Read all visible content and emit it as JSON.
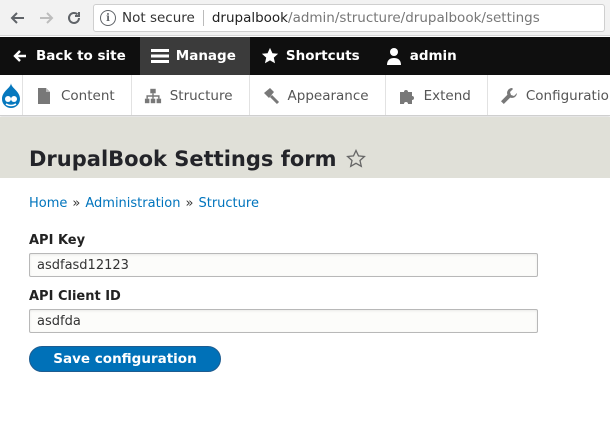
{
  "browser": {
    "security_label": "Not secure",
    "url_domain": "drupalbook",
    "url_path": "/admin/structure/drupalbook/settings"
  },
  "toolbar": {
    "items": [
      {
        "label": "Back to site",
        "icon": "drupal-drop-icon"
      },
      {
        "label": "Manage",
        "icon": "hamburger-menu-icon"
      },
      {
        "label": "Shortcuts",
        "icon": "star-icon"
      },
      {
        "label": "admin",
        "icon": "user-icon"
      }
    ]
  },
  "tray": {
    "items": [
      {
        "label": "Content",
        "icon": "file-icon"
      },
      {
        "label": "Structure",
        "icon": "sitemap-icon"
      },
      {
        "label": "Appearance",
        "icon": "paintbrush-icon"
      },
      {
        "label": "Extend",
        "icon": "puzzle-icon"
      },
      {
        "label": "Configuration",
        "icon": "wrench-icon"
      }
    ]
  },
  "page": {
    "title": "DrupalBook Settings form"
  },
  "breadcrumb": [
    "Home",
    "Administration",
    "Structure"
  ],
  "form": {
    "api_key_label": "API Key",
    "api_key_value": "asdfasd12123",
    "api_client_id_label": "API Client ID",
    "api_client_id_value": "asdfda",
    "submit_label": "Save configuration"
  },
  "colors": {
    "toolbar_bg": "#0f0f0f",
    "accent_blue": "#0071b8",
    "header_bg": "#e0e0d8",
    "link": "#0074bd"
  }
}
